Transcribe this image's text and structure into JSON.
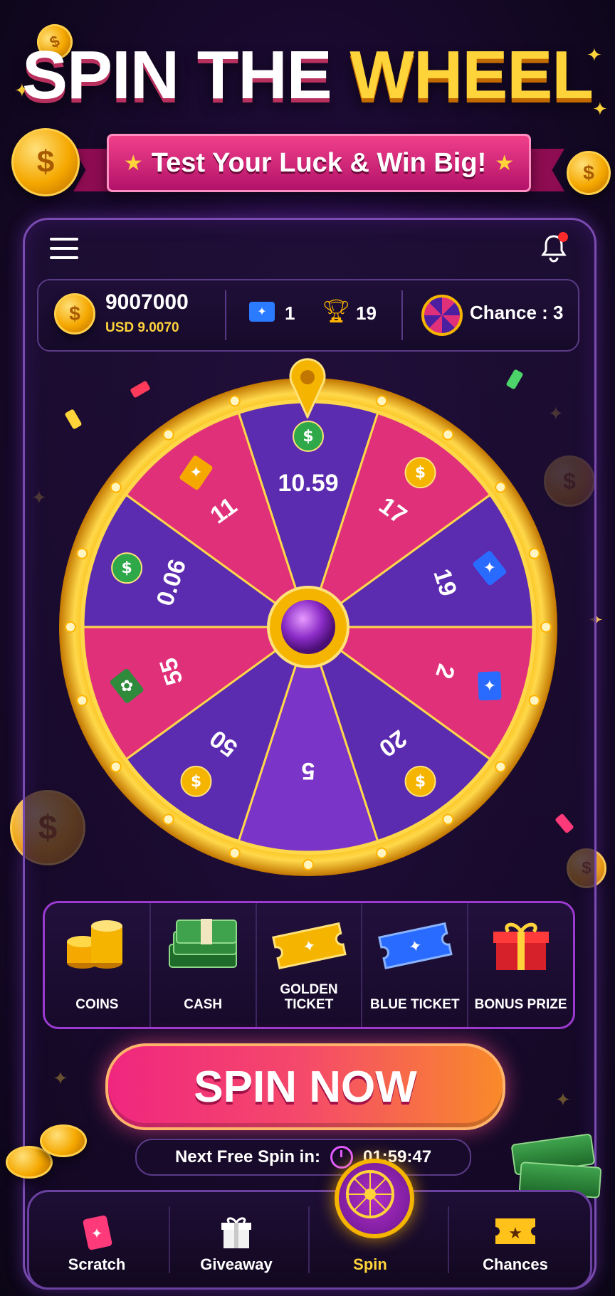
{
  "header": {
    "title_part1": "SPIN THE",
    "title_part2": "WHEEL",
    "subtitle": "Test Your Luck & Win Big!"
  },
  "topbar": {
    "menu_icon": "hamburger-icon",
    "notification_icon": "bell-icon"
  },
  "stats": {
    "coin_balance": "9007000",
    "usd_value": "USD 9.0070",
    "blue_tickets": "1",
    "trophies": "19",
    "chance_label": "Chance : 3"
  },
  "wheel": {
    "segments": [
      {
        "label": "10.59",
        "icon": "dollar-icon",
        "color": "#5b2bb0"
      },
      {
        "label": "17",
        "icon": "coin-icon",
        "color": "#e0307a"
      },
      {
        "label": "19",
        "icon": "blue-ticket-icon",
        "color": "#5b2bb0"
      },
      {
        "label": "2",
        "icon": "blue-ticket-icon",
        "color": "#e0307a"
      },
      {
        "label": "20",
        "icon": "coin-icon",
        "color": "#5b2bb0"
      },
      {
        "label": "5",
        "icon": "",
        "color": "#7a34c8"
      },
      {
        "label": "50",
        "icon": "coin-icon",
        "color": "#5b2bb0"
      },
      {
        "label": "55",
        "icon": "cash-icon",
        "color": "#e0307a"
      },
      {
        "label": "0.06",
        "icon": "dollar-icon",
        "color": "#5b2bb0"
      },
      {
        "label": "11",
        "icon": "golden-ticket-icon",
        "color": "#e0307a"
      }
    ]
  },
  "prizes": [
    {
      "label": "COINS",
      "icon": "coin-stack-icon"
    },
    {
      "label": "CASH",
      "icon": "cash-stack-icon"
    },
    {
      "label": "GOLDEN TICKET",
      "icon": "golden-ticket-icon"
    },
    {
      "label": "BLUE TICKET",
      "icon": "blue-ticket-icon"
    },
    {
      "label": "BONUS PRIZE",
      "icon": "gift-box-icon"
    }
  ],
  "spin_button": {
    "label": "SPIN NOW"
  },
  "timer": {
    "label": "Next Free Spin in:",
    "value": "01:59:47"
  },
  "nav": [
    {
      "label": "Scratch",
      "icon": "scratch-card-icon"
    },
    {
      "label": "Giveaway",
      "icon": "gift-icon"
    },
    {
      "label": "Spin",
      "icon": "wheel-icon",
      "active": true
    },
    {
      "label": "Chances",
      "icon": "star-ticket-icon"
    }
  ],
  "colors": {
    "accent_gold": "#ffd43b",
    "accent_pink": "#f0267f",
    "background": "#1c0a33"
  }
}
